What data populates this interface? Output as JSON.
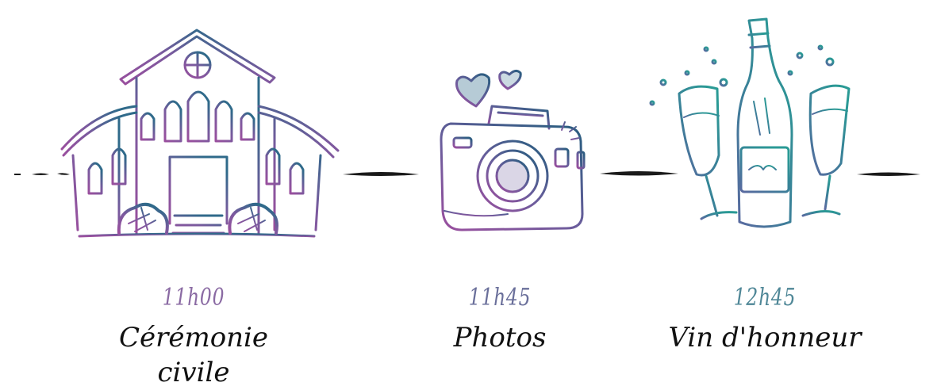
{
  "colors": {
    "purple": "#9a4f9e",
    "teal": "#2a8a95",
    "navy": "#2f5d82",
    "ink": "#111111",
    "time_purple": "#8a6aa3",
    "time_mid": "#6a6f9a",
    "time_teal": "#4f8797"
  },
  "events": [
    {
      "time": "11h00",
      "label": "Cérémonie civile",
      "icon": "town-hall-icon"
    },
    {
      "time": "11h45",
      "label": "Photos",
      "icon": "camera-icon"
    },
    {
      "time": "12h45",
      "label": "Vin d'honneur",
      "icon": "champagne-icon"
    }
  ]
}
